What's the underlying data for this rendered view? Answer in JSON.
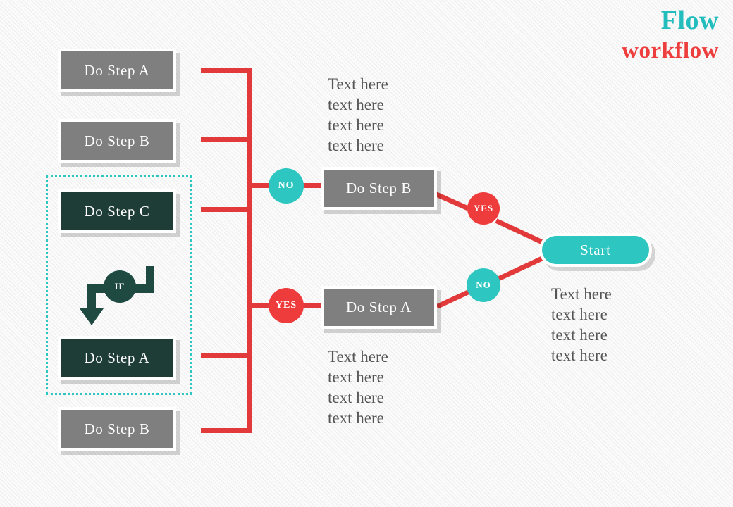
{
  "title": {
    "line1": "Flow",
    "line2": "workflow",
    "color_primary": "#23BDBD",
    "color_secondary": "#EE3D3D"
  },
  "palette": {
    "gray_box": "#7f7f7f",
    "dark_box": "#1E3D37",
    "teal": "#2EC6C0",
    "red": "#E23A3A",
    "dark_teal": "#1E4A42",
    "text_gray": "#555555"
  },
  "left_column": {
    "items": [
      {
        "label": "Do Step A",
        "style": "gray"
      },
      {
        "label": "Do Step B",
        "style": "gray"
      },
      {
        "label": "Do Step C",
        "style": "dark"
      },
      {
        "label": "Do Step A",
        "style": "dark"
      },
      {
        "label": "Do Step B",
        "style": "gray"
      }
    ]
  },
  "if_node": {
    "label": "IF"
  },
  "branches": {
    "top": {
      "decision_label": "NO",
      "decision_color": "#2EC6C0",
      "box_label": "Do Step B",
      "box_style": "gray",
      "outcome_label": "YES",
      "outcome_color": "#EE3B3B",
      "note": "Text here\ntext here\ntext here\ntext here"
    },
    "bottom": {
      "decision_label": "YES",
      "decision_color": "#EE3B3B",
      "box_label": "Do Step A",
      "box_style": "gray",
      "outcome_label": "NO",
      "outcome_color": "#2EC6C0",
      "note": "Text here\ntext here\ntext here\ntext here"
    }
  },
  "start_node": {
    "label": "Start",
    "note": "Text here\ntext here\ntext here\ntext here"
  }
}
